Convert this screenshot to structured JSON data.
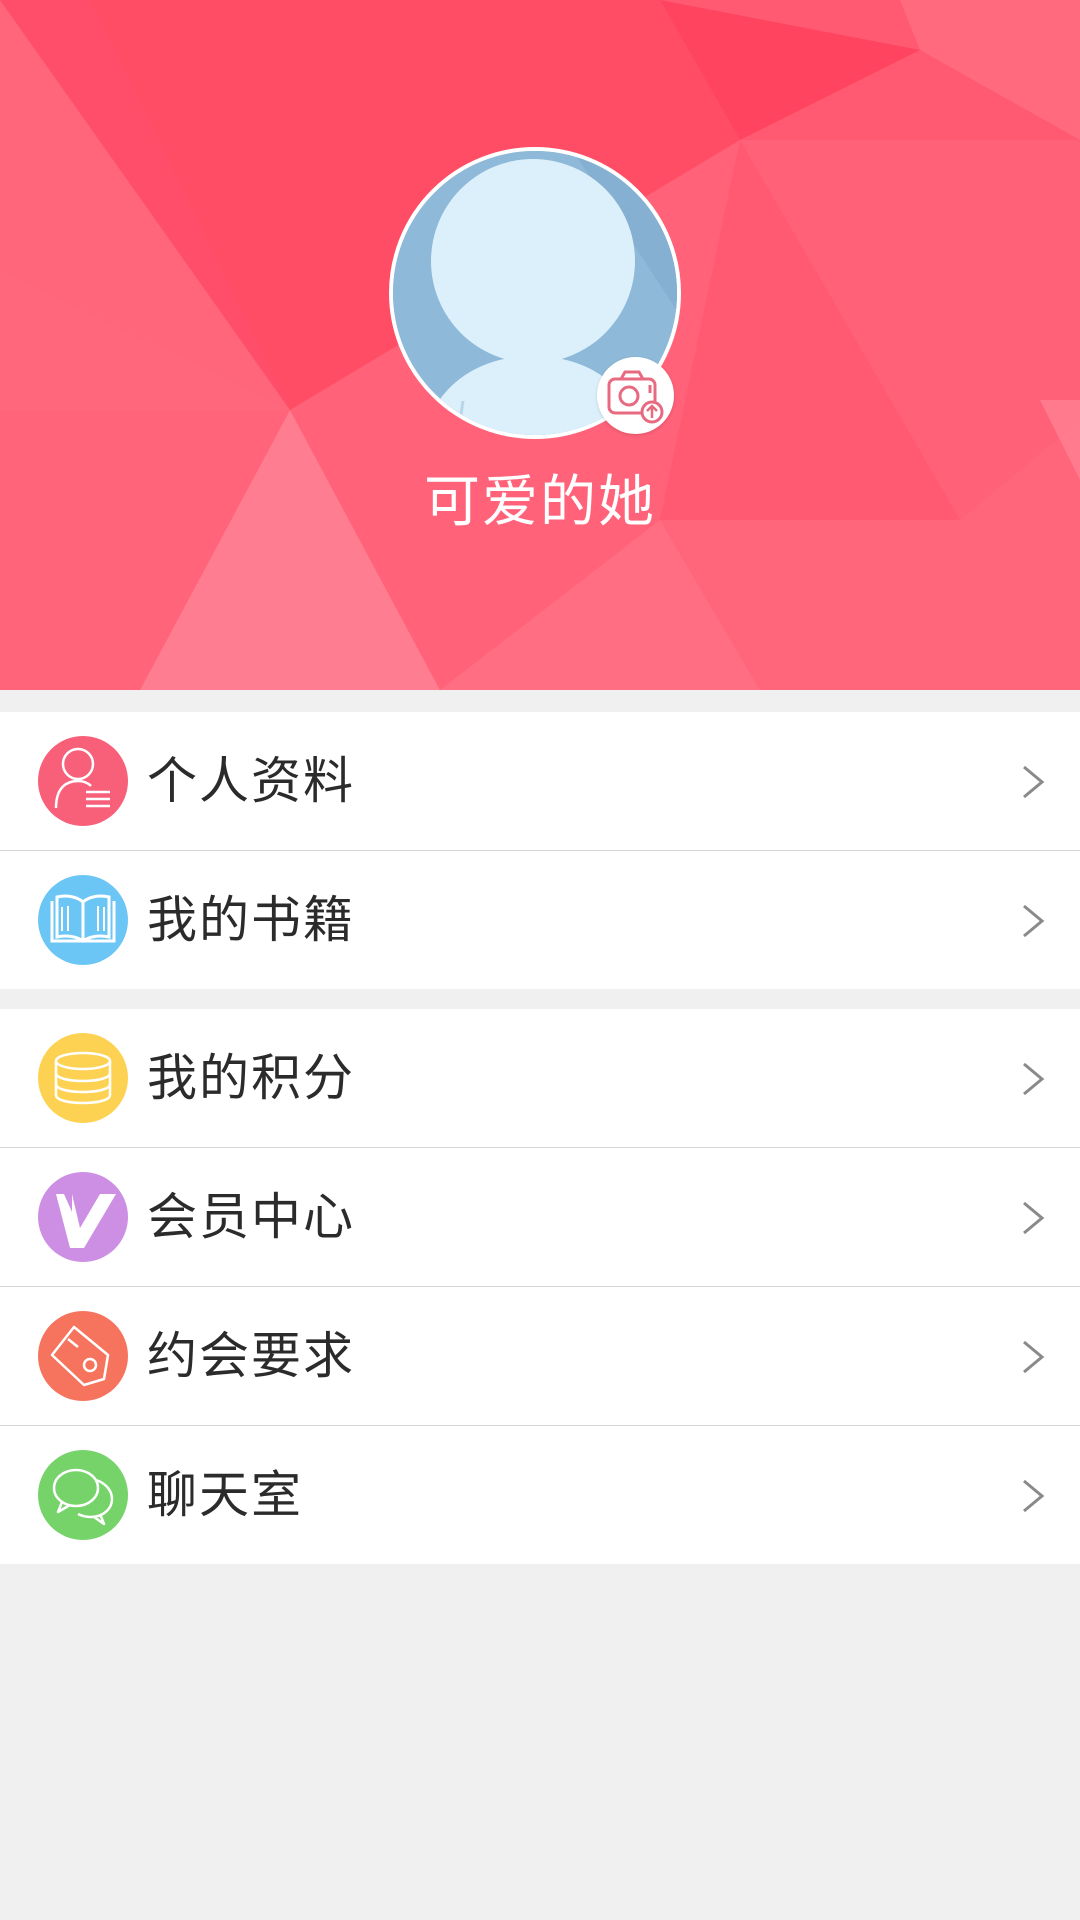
{
  "profile": {
    "nickname": "可爱的她",
    "avatar_icon": "default-avatar-icon",
    "upload_icon": "camera-upload-icon"
  },
  "menu_groups": [
    {
      "items": [
        {
          "label": "个人资料",
          "icon": "personal-info-icon",
          "icon_color": "#f8607a"
        },
        {
          "label": "我的书籍",
          "icon": "book-icon",
          "icon_color": "#6cc6f5"
        }
      ]
    },
    {
      "items": [
        {
          "label": "我的积分",
          "icon": "coins-icon",
          "icon_color": "#fdd252"
        },
        {
          "label": "会员中心",
          "icon": "vip-icon",
          "icon_color": "#cc8fe4"
        },
        {
          "label": "约会要求",
          "icon": "tag-icon",
          "icon_color": "#f6745e"
        },
        {
          "label": "聊天室",
          "icon": "chat-icon",
          "icon_color": "#76d36a"
        }
      ]
    }
  ],
  "colors": {
    "header_bg": "#ff5a72",
    "page_bg": "#f0f0f0",
    "chevron": "#8a8a8a"
  }
}
